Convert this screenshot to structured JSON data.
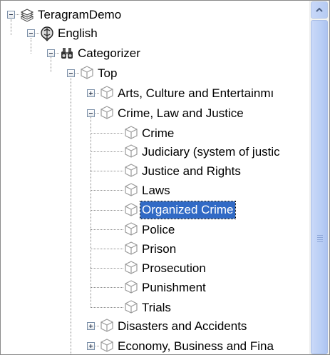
{
  "tree": {
    "nodes": [
      {
        "label": "TeragramDemo",
        "icon": "books-stack-icon",
        "toggle": "collapse"
      },
      {
        "label": "English",
        "icon": "language-globe-icon",
        "toggle": "collapse"
      },
      {
        "label": "Categorizer",
        "icon": "binoculars-icon",
        "toggle": "collapse"
      },
      {
        "label": "Top",
        "icon": "category-cube-icon",
        "toggle": "collapse"
      },
      {
        "label": "Arts, Culture and Entertainmı",
        "icon": "category-cube-icon",
        "toggle": "expand"
      },
      {
        "label": "Crime, Law and Justice",
        "icon": "category-cube-icon",
        "toggle": "collapse"
      },
      {
        "label": "Crime",
        "icon": "category-cube-icon",
        "toggle": "none"
      },
      {
        "label": "Judiciary (system of justic",
        "icon": "category-cube-icon",
        "toggle": "none"
      },
      {
        "label": "Justice and Rights",
        "icon": "category-cube-icon",
        "toggle": "none"
      },
      {
        "label": "Laws",
        "icon": "category-cube-icon",
        "toggle": "none"
      },
      {
        "label": "Organized Crime",
        "icon": "category-cube-icon",
        "toggle": "none",
        "selected": true
      },
      {
        "label": "Police",
        "icon": "category-cube-icon",
        "toggle": "none"
      },
      {
        "label": "Prison",
        "icon": "category-cube-icon",
        "toggle": "none"
      },
      {
        "label": "Prosecution",
        "icon": "category-cube-icon",
        "toggle": "none"
      },
      {
        "label": "Punishment",
        "icon": "category-cube-icon",
        "toggle": "none"
      },
      {
        "label": "Trials",
        "icon": "category-cube-icon",
        "toggle": "none"
      },
      {
        "label": "Disasters and Accidents",
        "icon": "category-cube-icon",
        "toggle": "expand"
      },
      {
        "label": "Economy, Business and Fina",
        "icon": "category-cube-icon",
        "toggle": "expand"
      }
    ]
  },
  "colors": {
    "selection": "#316ac5",
    "scrollbar": "#b9cef5"
  }
}
